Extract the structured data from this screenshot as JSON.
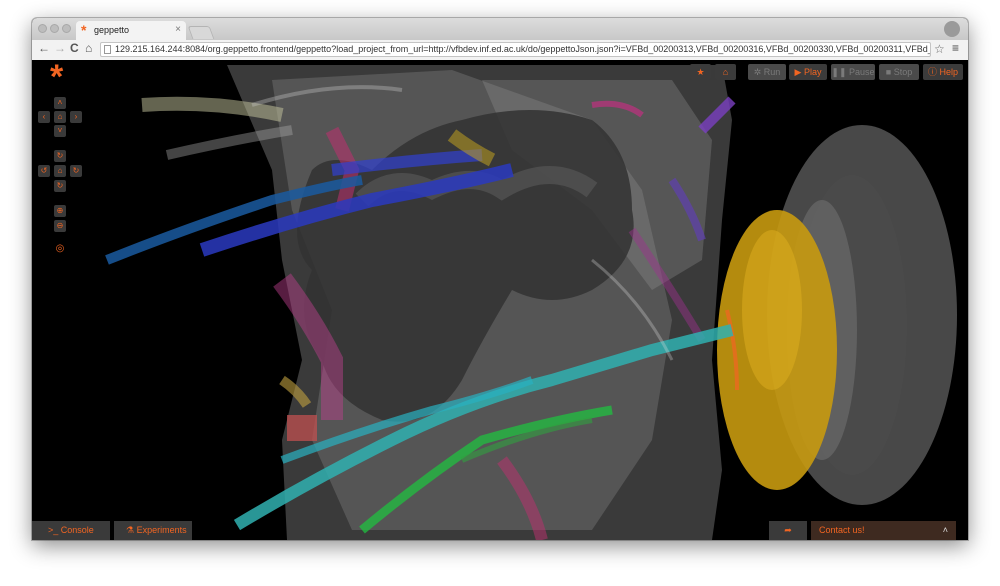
{
  "browser": {
    "tab_title": "geppetto",
    "tab_close": "×",
    "url": "129.215.164.244:8084/org.geppetto.frontend/geppetto?load_project_from_url=http://vfbdev.inf.ed.ac.uk/do/geppettoJson.json?i=VFBd_00200313,VFBd_00200316,VFBd_00200330,VFBd_00200311,VFBd_002003...",
    "nav": {
      "back": "←",
      "forward": "→",
      "reload": "C",
      "home": "⌂"
    },
    "bookmark_star": "☆",
    "menu": "≡"
  },
  "app": {
    "logo": "*",
    "controls": {
      "pan_up": "˄",
      "pan_left": "‹",
      "pan_home": "⌂",
      "pan_right": "›",
      "pan_down": "˅",
      "rot_up": "↻",
      "rot_left": "↺",
      "rot_home": "⌂",
      "rot_right": "↻",
      "rot_down": "↻",
      "zoom_in": "⊕",
      "zoom_out": "⊖",
      "github": "◎"
    },
    "toolbar": {
      "star": "★",
      "home": "⌂",
      "run": "Run",
      "play": "Play",
      "pause": "Pause",
      "stop": "Stop",
      "help": "Help",
      "run_icon": "✲",
      "play_icon": "▶",
      "pause_icon": "❚❚",
      "stop_icon": "■",
      "help_icon": "ⓘ"
    },
    "bottom": {
      "console": "Console",
      "console_icon": ">_",
      "experiments": "Experiments",
      "experiments_icon": "⚗",
      "share_icon": "➦",
      "contact": "Contact us!",
      "contact_chevron": "˄"
    }
  },
  "colors": {
    "accent": "#f26522",
    "button_bg": "#3b3b3b",
    "disabled_bg": "#4a4a4a",
    "disabled_text": "#7a7a7a"
  }
}
